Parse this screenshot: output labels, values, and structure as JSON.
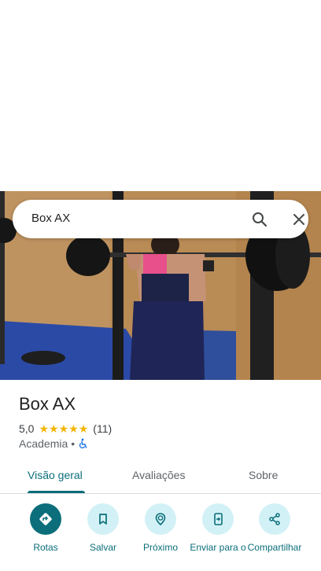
{
  "search": {
    "query": "Box AX"
  },
  "place": {
    "title": "Box AX",
    "rating": "5,0",
    "stars": 5,
    "reviews_count": "(11)",
    "category": "Academia",
    "separator": "•"
  },
  "tabs": [
    {
      "label": "Visão geral",
      "active": true
    },
    {
      "label": "Avaliações",
      "active": false
    },
    {
      "label": "Sobre",
      "active": false
    }
  ],
  "actions": [
    {
      "label": "Rotas",
      "icon": "directions-icon"
    },
    {
      "label": "Salvar",
      "icon": "bookmark-icon"
    },
    {
      "label": "Próximo",
      "icon": "nearby-icon"
    },
    {
      "label": "Enviar para o",
      "icon": "send-to-phone-icon"
    },
    {
      "label": "Compartilhar",
      "icon": "share-icon"
    }
  ],
  "colors": {
    "accent": "#0b6e7a",
    "accent_light": "#d2f1f6",
    "star": "#f4b400"
  }
}
